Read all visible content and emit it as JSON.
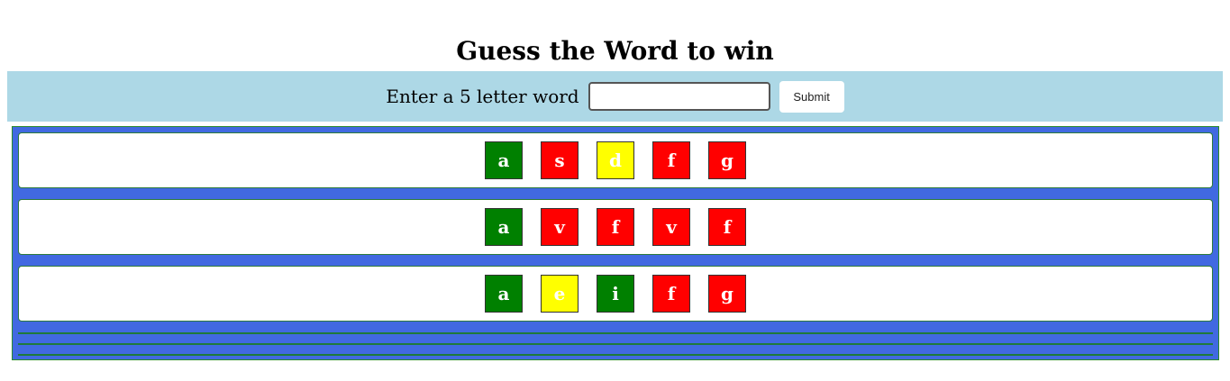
{
  "header": {
    "title": "Guess the Word to win"
  },
  "input_bar": {
    "label": "Enter a 5 letter word",
    "value": "",
    "submit_label": "Submit",
    "background": "#add8e6"
  },
  "board": {
    "background": "#4169e1",
    "colors": {
      "correct": "#008000",
      "present": "#ffff00",
      "absent": "#ff0000"
    },
    "rows": [
      {
        "tiles": [
          {
            "letter": "a",
            "status": "correct"
          },
          {
            "letter": "s",
            "status": "absent"
          },
          {
            "letter": "d",
            "status": "present"
          },
          {
            "letter": "f",
            "status": "absent"
          },
          {
            "letter": "g",
            "status": "absent"
          }
        ]
      },
      {
        "tiles": [
          {
            "letter": "a",
            "status": "correct"
          },
          {
            "letter": "v",
            "status": "absent"
          },
          {
            "letter": "f",
            "status": "absent"
          },
          {
            "letter": "v",
            "status": "absent"
          },
          {
            "letter": "f",
            "status": "absent"
          }
        ]
      },
      {
        "tiles": [
          {
            "letter": "a",
            "status": "correct"
          },
          {
            "letter": "e",
            "status": "present"
          },
          {
            "letter": "i",
            "status": "correct"
          },
          {
            "letter": "f",
            "status": "absent"
          },
          {
            "letter": "g",
            "status": "absent"
          }
        ]
      }
    ],
    "empty_rows": 3
  }
}
